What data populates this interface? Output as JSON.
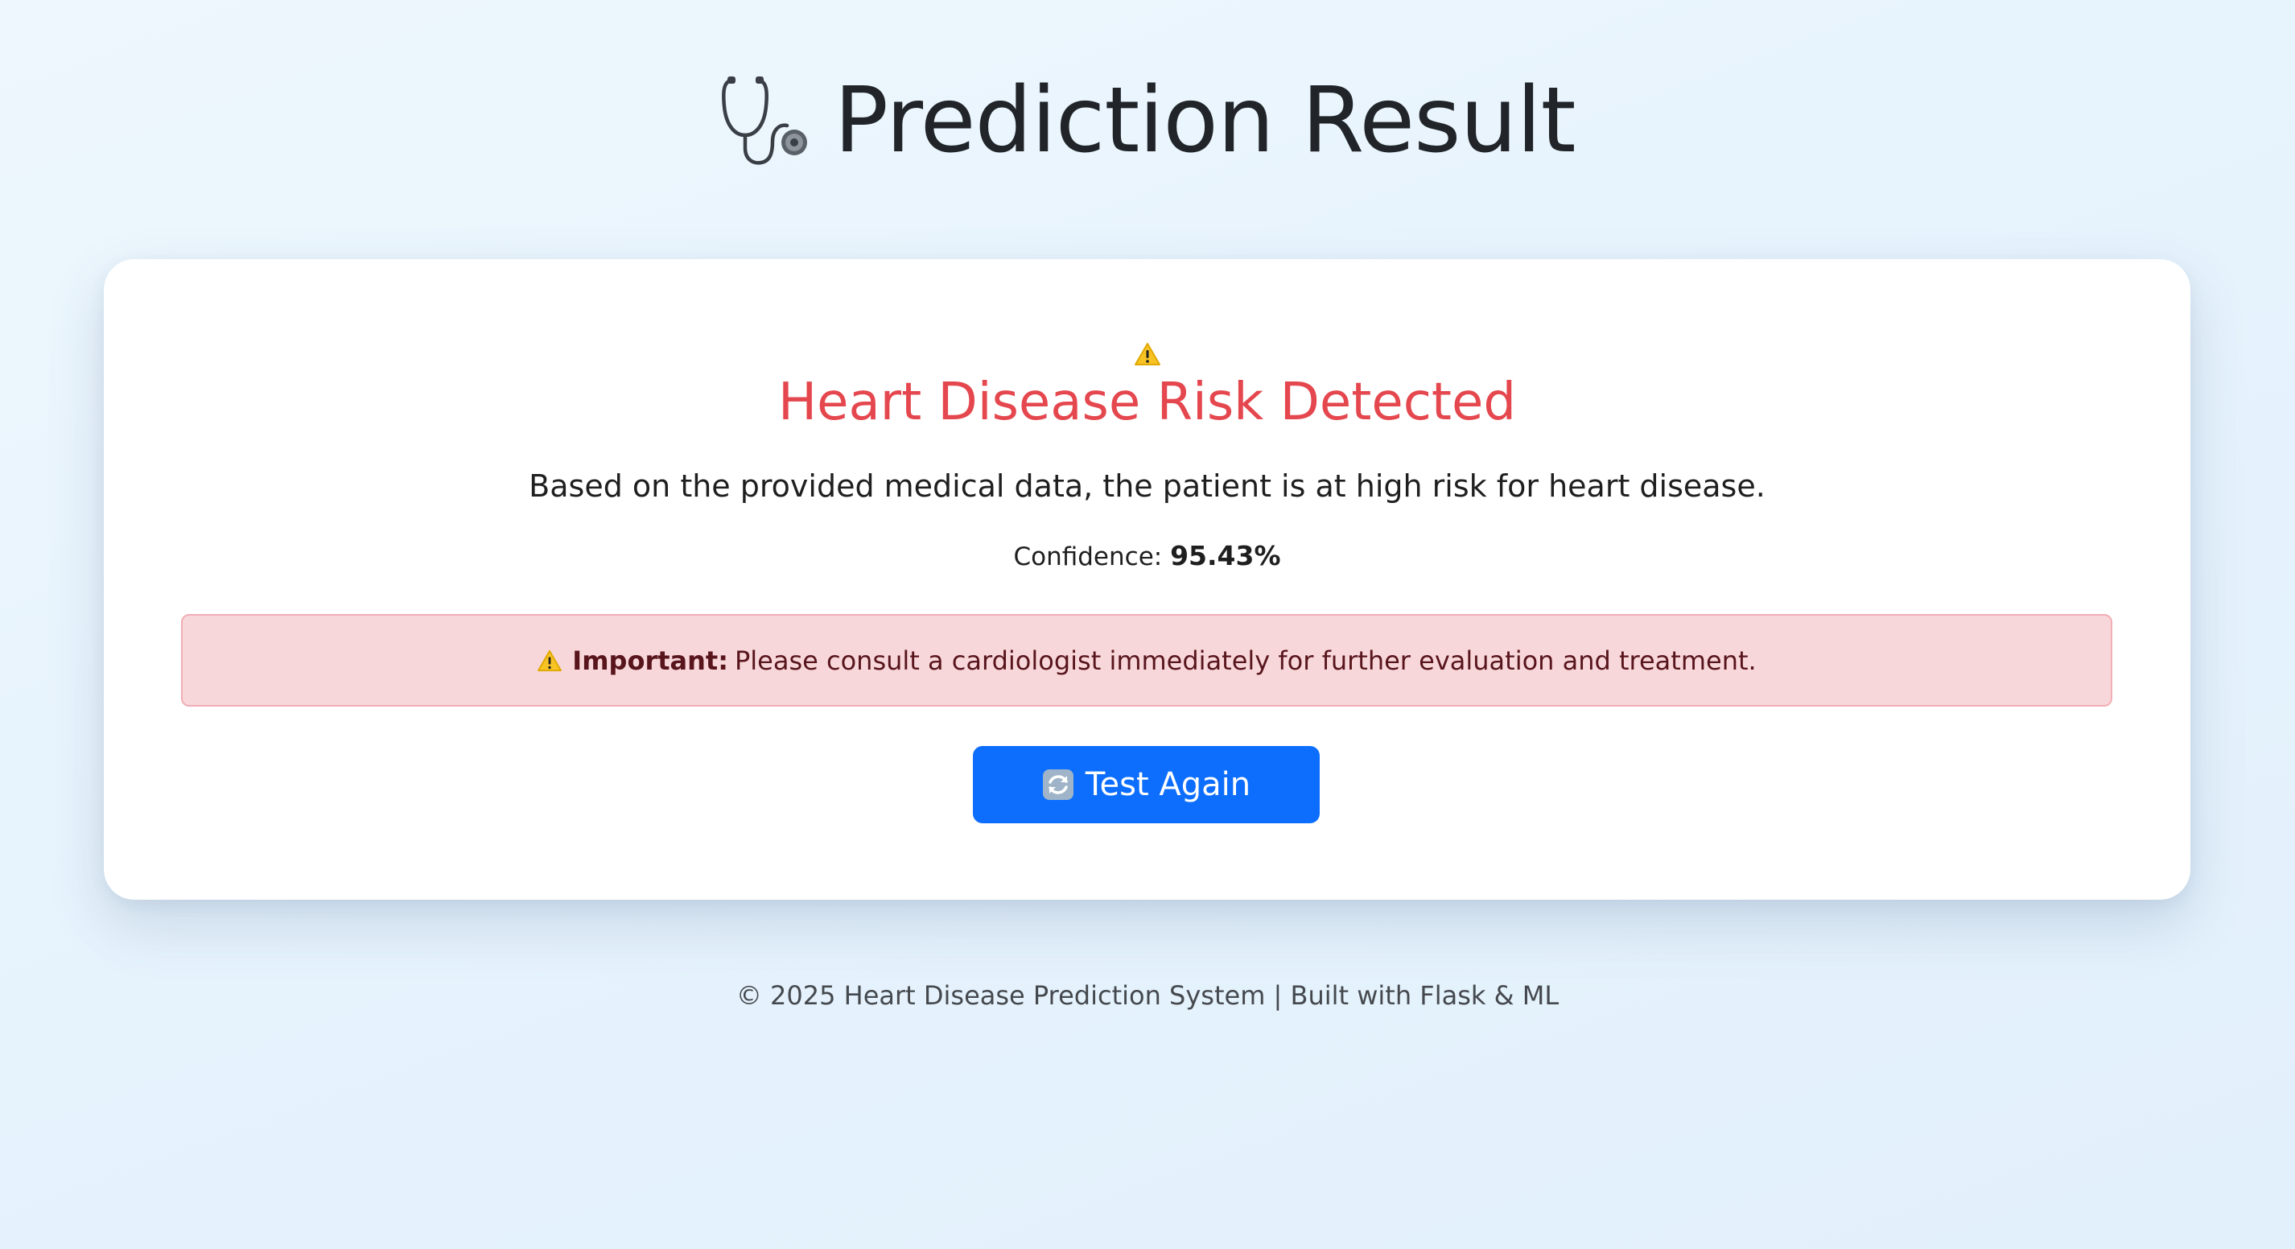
{
  "header": {
    "icon": "stethoscope-icon",
    "title": "Prediction Result"
  },
  "result": {
    "warning_icon": "warning-icon",
    "title": "Heart Disease Risk Detected",
    "description": "Based on the provided medical data, the patient is at high risk for heart disease.",
    "confidence_label": "Confidence:",
    "confidence_value": "95.43%"
  },
  "alert": {
    "icon": "warning-icon",
    "strong": "Important:",
    "text": "Please consult a cardiologist immediately for further evaluation and treatment."
  },
  "button": {
    "icon": "refresh-icon",
    "label": "Test Again"
  },
  "footer": {
    "text": "© 2025 Heart Disease Prediction System | Built with Flask & ML"
  },
  "colors": {
    "danger": "#e5474e",
    "primary": "#0d6efd",
    "alert_bg": "#f8d7da",
    "alert_text": "#58151c"
  }
}
